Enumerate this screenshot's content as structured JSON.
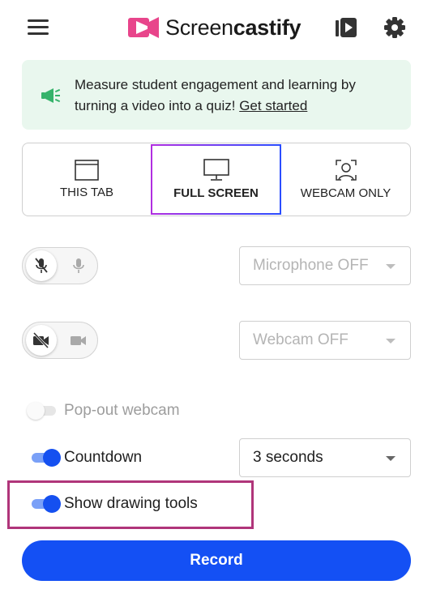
{
  "header": {
    "logo_prefix": "Screen",
    "logo_suffix": "castify",
    "icons": {
      "menu": "hamburger-menu-icon",
      "library": "video-library-icon",
      "settings": "gear-icon"
    }
  },
  "banner": {
    "text": "Measure student engagement and learning by turning a video into a quiz!",
    "link": "Get started",
    "icon": "megaphone-icon"
  },
  "modes": [
    {
      "label": "THIS TAB",
      "icon": "browser-tab-icon",
      "selected": false
    },
    {
      "label": "FULL SCREEN",
      "icon": "monitor-icon",
      "selected": true
    },
    {
      "label": "WEBCAM ONLY",
      "icon": "webcam-person-icon",
      "selected": false
    }
  ],
  "microphone": {
    "select_value": "Microphone OFF",
    "state": "off"
  },
  "webcam": {
    "select_value": "Webcam OFF",
    "state": "off"
  },
  "options": {
    "popout_webcam": {
      "label": "Pop-out webcam",
      "on": false,
      "disabled": true
    },
    "countdown": {
      "label": "Countdown",
      "on": true,
      "value": "3 seconds"
    },
    "drawing_tools": {
      "label": "Show drawing tools",
      "on": true
    }
  },
  "record_label": "Record",
  "colors": {
    "accent": "#1450f4",
    "banner_bg": "#e9f7ee",
    "logo_pink": "#e8458b",
    "highlight": "#b0357a"
  }
}
